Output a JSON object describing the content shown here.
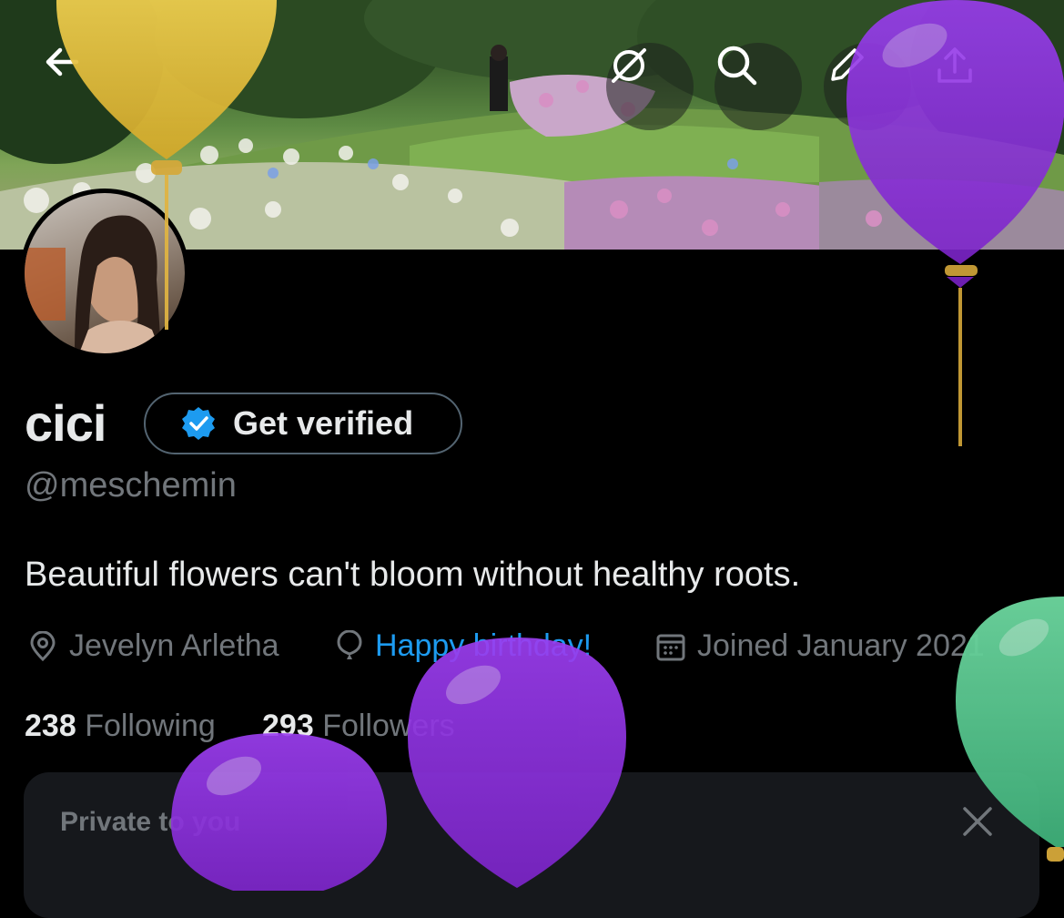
{
  "header": {
    "back_icon": "arrow-left-icon",
    "actions": [
      {
        "name": "grok-icon"
      },
      {
        "name": "search-icon"
      },
      {
        "name": "edit-icon"
      },
      {
        "name": "share-icon"
      }
    ]
  },
  "profile": {
    "display_name": "cici",
    "verify_button_label": "Get verified",
    "handle": "@meschemin",
    "bio": "Beautiful flowers can't bloom without healthy roots.",
    "location": "Jevelyn Arletha",
    "birthday": "Happy birthday!",
    "joined": "Joined January 2021",
    "following_count": "238",
    "following_label": "Following",
    "followers_count": "293",
    "followers_label": "Followers"
  },
  "private_card": {
    "title": "Private to you",
    "close_icon": "close-icon"
  },
  "colors": {
    "background": "#000000",
    "text_primary": "#e7e9ea",
    "text_secondary": "#71767b",
    "link": "#1d9bf0",
    "verified_badge": "#1d9bf0",
    "balloon_yellow": "#e8c33f",
    "balloon_purple": "#8a2be2",
    "balloon_green": "#5fcf95"
  }
}
